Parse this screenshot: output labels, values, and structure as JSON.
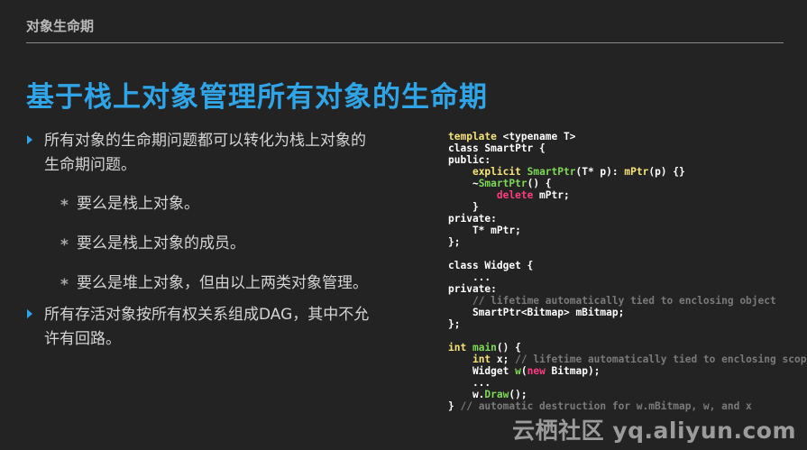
{
  "header": {
    "title": "对象生命期"
  },
  "slide": {
    "title": "基于栈上对象管理所有对象的生命期"
  },
  "bullets": [
    {
      "line1": "所有对象的生命期问题都可以转化为栈上对象的",
      "line2": "生命期问题。",
      "sub": [
        "要么是栈上对象。",
        "要么是栈上对象的成员。",
        "要么是堆上对象，但由以上两类对象管理。"
      ]
    },
    {
      "line1": "所有存活对象按所有权关系组成DAG，其中不允",
      "line2": "许有回路。"
    }
  ],
  "code": {
    "l1a": "template",
    "l1b": " <typename T>",
    "l2": "class SmartPtr {",
    "l3": "public:",
    "l4a": "    ",
    "l4b": "explicit",
    "l4c": " ",
    "l4d": "SmartPtr",
    "l4e": "(T* p): ",
    "l4f": "mPtr",
    "l4g": "(p) {}",
    "l5a": "    ~",
    "l5b": "SmartPtr",
    "l5c": "() {",
    "l6a": "        ",
    "l6b": "delete",
    "l6c": " mPtr;",
    "l7": "    }",
    "l8": "private:",
    "l9": "    T* mPtr;",
    "l10": "};",
    "l12": "class Widget {",
    "l13": "    ...",
    "l14": "private:",
    "l15a": "    ",
    "l15b": "// lifetime automatically tied to enclosing object",
    "l16": "    SmartPtr<Bitmap> mBitmap;",
    "l17": "};",
    "l19a": "int",
    "l19b": " ",
    "l19c": "main",
    "l19d": "() {",
    "l20a": "    ",
    "l20b": "int",
    "l20c": " x; ",
    "l20d": "// lifetime automatically tied to enclosing scope",
    "l21a": "    Widget ",
    "l21b": "w",
    "l21c": "(",
    "l21d": "new",
    "l21e": " Bitmap);",
    "l22": "    ...",
    "l23a": "    w.",
    "l23b": "Draw",
    "l23c": "();",
    "l24a": "} ",
    "l24b": "// automatic destruction for w.mBitmap, w, and x"
  },
  "watermark": {
    "text": "云栖社区 yq.aliyun.com"
  }
}
